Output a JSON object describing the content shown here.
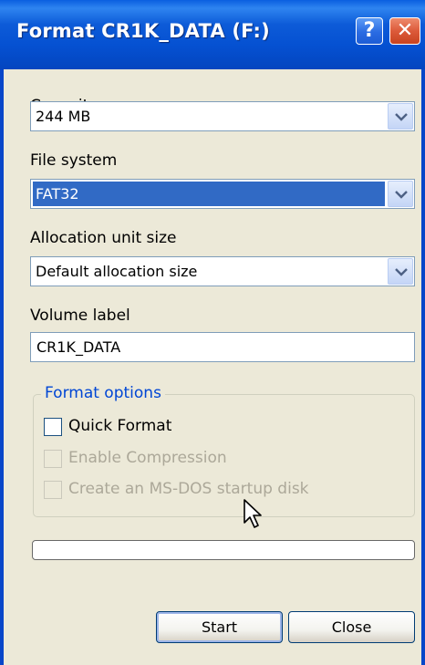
{
  "window": {
    "title": "Format CR1K_DATA (F:)",
    "help_glyph": "?",
    "close_glyph": "✕"
  },
  "capacity": {
    "label": "Capacity:",
    "value": "244 MB"
  },
  "file_system": {
    "label": "File system",
    "value": "FAT32"
  },
  "allocation": {
    "label": "Allocation unit size",
    "value": "Default allocation size"
  },
  "volume": {
    "label": "Volume label",
    "value": "CR1K_DATA"
  },
  "options": {
    "title": "Format options",
    "quick_format": {
      "label": "Quick Format",
      "checked": false,
      "enabled": true
    },
    "compression": {
      "label": "Enable Compression",
      "checked": false,
      "enabled": false
    },
    "msdos": {
      "label": "Create an MS-DOS startup disk",
      "checked": false,
      "enabled": false
    }
  },
  "progress": {
    "value": 0
  },
  "buttons": {
    "start": "Start",
    "close": "Close"
  },
  "colors": {
    "title_bar": "#0551d2",
    "selection": "#316ac5",
    "group_title": "#0046d5",
    "disabled_text": "#aca899"
  }
}
